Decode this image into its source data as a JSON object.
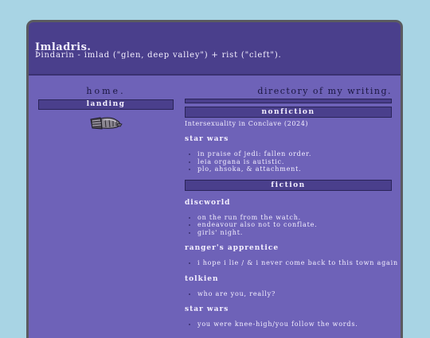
{
  "header": {
    "title": "Imladris.",
    "subtitle": "Þindarin - imlad (\"glen, deep valley\") + rist (\"cleft\")."
  },
  "sidebar": {
    "home_label": "home.",
    "landing_label": "landing",
    "image_icon": "gauntlet-icon"
  },
  "main": {
    "title": "directory of my writing.",
    "nonfiction": {
      "heading": "nonfiction",
      "standalone": "Intersexuality in Conclave (2024)",
      "categories": [
        {
          "name": "star wars",
          "items": [
            "in praise of jedi: fallen order.",
            "leia organa is autistic.",
            "plo, ahsoka, & attachment."
          ]
        }
      ]
    },
    "fiction": {
      "heading": "fiction",
      "categories": [
        {
          "name": "discworld",
          "items": [
            "on the run from the watch.",
            "endeavour also not to conflate.",
            "girls' night."
          ]
        },
        {
          "name": "ranger's apprentice",
          "items": [
            "i hope i lie / & i never come back to this town again"
          ]
        },
        {
          "name": "tolkien",
          "items": [
            "who are you, really?"
          ]
        },
        {
          "name": "star wars",
          "items": [
            "you were knee-high/you follow the words."
          ]
        }
      ]
    }
  },
  "colors": {
    "page_background": "#a8d4e4",
    "panel": "#6e62b8",
    "header": "#4a3f8c",
    "text_light": "#f4f0ff",
    "text_dark": "#1a1640"
  }
}
